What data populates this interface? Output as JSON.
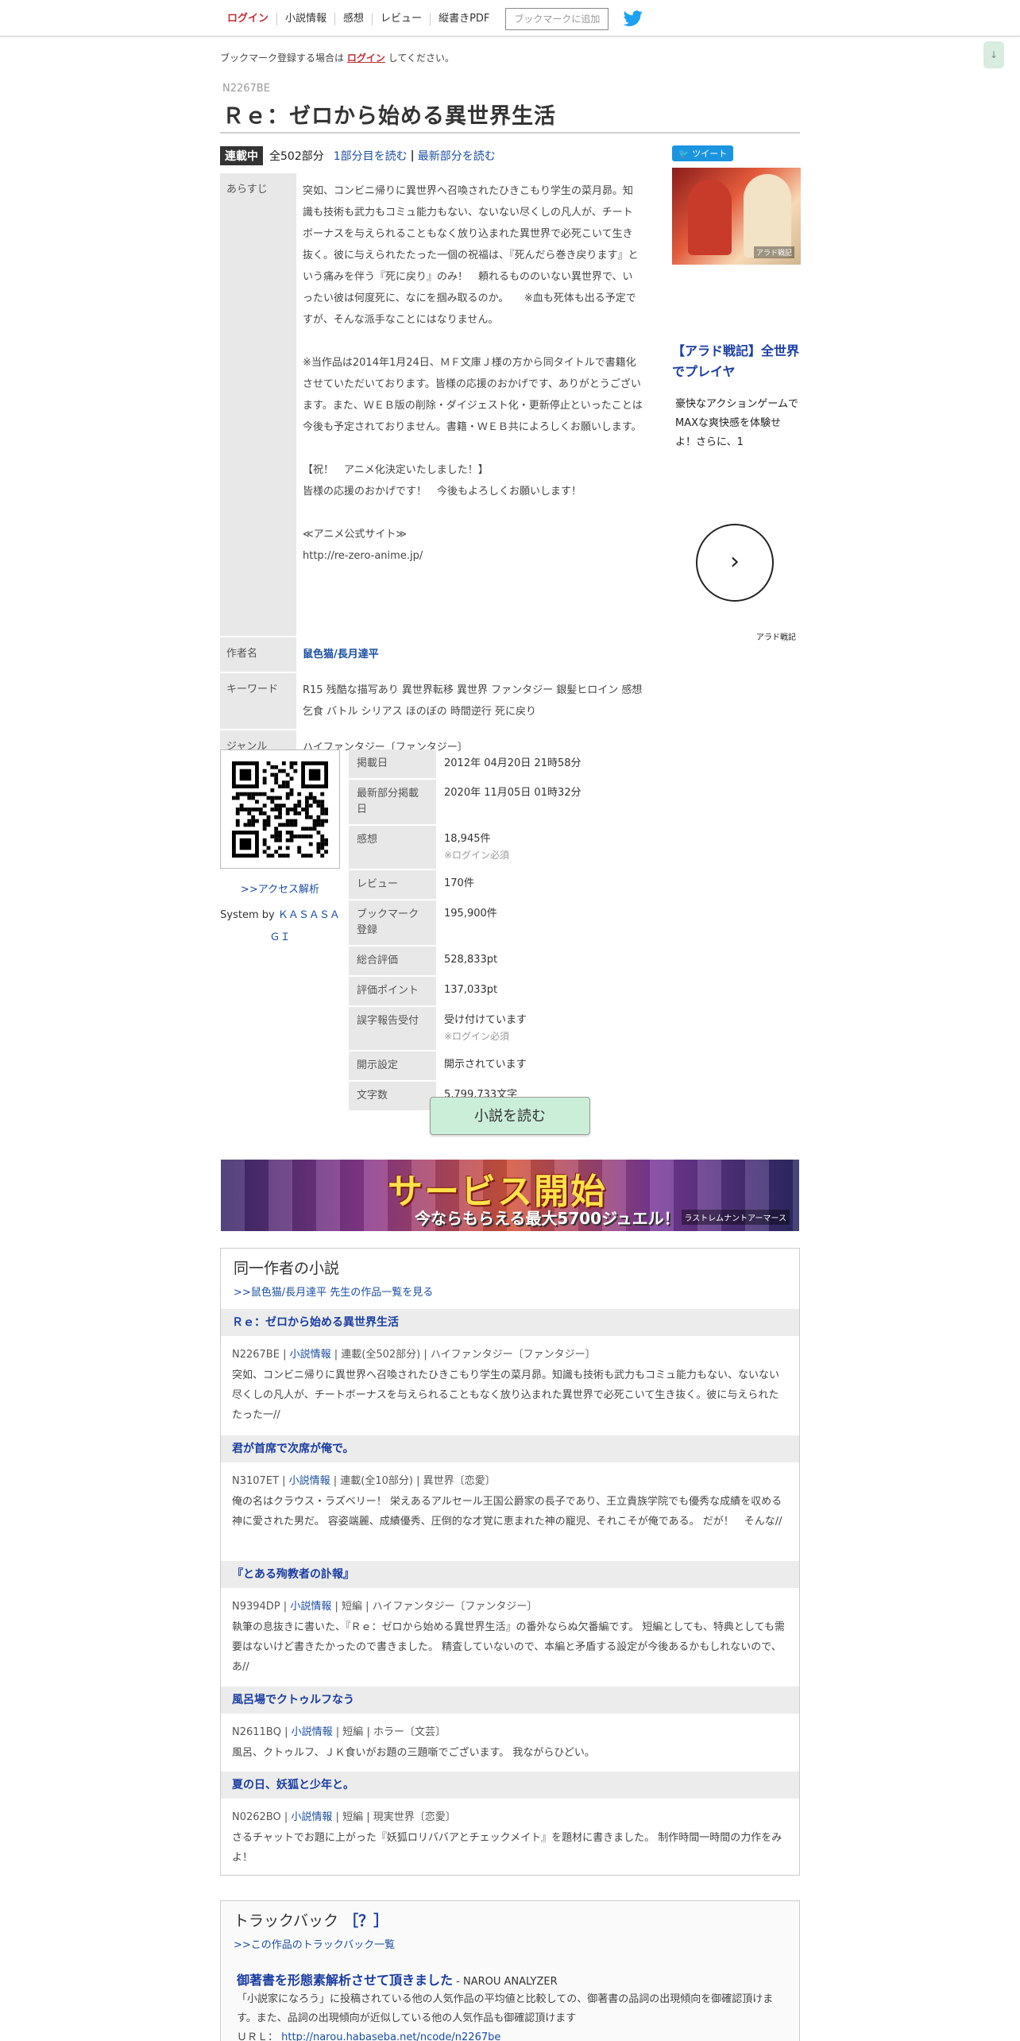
{
  "nav": {
    "login": "ログイン",
    "novel_info": "小説情報",
    "impressions": "感想",
    "review": "レビュー",
    "vertical_pdf": "縦書きPDF",
    "bookmark_button": "ブックマークに追加"
  },
  "scroll_top": "↓",
  "notice": {
    "prefix": "ブックマーク登録する場合は",
    "login": "ログイン",
    "suffix": "してください。"
  },
  "novel": {
    "ncode": "N2267BE",
    "title": "Ｒｅ：ゼロから始める異世界生活",
    "status": "連載中",
    "parts": "全502部分",
    "read_first": "1部分目を読む",
    "separator": "|",
    "read_latest": "最新部分を読む"
  },
  "info": {
    "synopsis_label": "あらすじ",
    "synopsis_p1": "突如、コンビニ帰りに異世界へ召喚されたひきこもり学生の菜月昴。知識も技術も武力もコミュ能力もない、ないない尽くしの凡人が、チートボーナスを与えられることもなく放り込まれた異世界で必死こいて生き抜く。彼に与えられたたった一個の祝福は、『死んだら巻き戻ります』という痛みを伴う『死に戻り』のみ！　頼れるもののいない異世界で、いったい彼は何度死に、なにを掴み取るのか。　　※血も死体も出る予定ですが、そんな派手なことにはなりません。",
    "synopsis_p2": "※当作品は2014年1月24日、ＭＦ文庫Ｊ様の方から同タイトルで書籍化させていただいております。皆様の応援のおかげです、ありがとうございます。また、ＷＥＢ版の削除・ダイジェスト化・更新停止といったことは今後も予定されておりません。書籍・ＷＥＢ共によろしくお願いします。",
    "synopsis_p3a": "【祝！　アニメ化決定いたしました！】",
    "synopsis_p3b": "皆様の応援のおかげです！　今後もよろしくお願いします！",
    "synopsis_p4a": "≪アニメ公式サイト≫",
    "synopsis_p4b": "http://re-zero-anime.jp/",
    "author_label": "作者名",
    "author": "鼠色猫/長月達平",
    "keyword_label": "キーワード",
    "keywords": "R15 残酷な描写あり 異世界転移  異世界 ファンタジー 銀髪ヒロイン 感想乞食 バトル シリアス ほのぼの 時間逆行 死に戻り",
    "genre_label": "ジャンル",
    "genre": "ハイファンタジー〔ファンタジー〕"
  },
  "ad": {
    "tweet": "ツイート",
    "image_logo": "アラド戦記",
    "title": "【アラド戦記】全世界でプレイヤ",
    "desc": "豪快なアクションゲームでMAXな爽快感を体験せよ！さらに、1",
    "next": "›",
    "brand": "アラド戦記"
  },
  "qr": {
    "access_link": ">>アクセス解析",
    "system_by": "System by",
    "system_name": "ＫＡＳＡＳＡＧＩ"
  },
  "stats": [
    {
      "label": "掲載日",
      "value": "2012年 04月20日 21時58分",
      "sub": ""
    },
    {
      "label": "最新部分掲載日",
      "value": "2020年 11月05日 01時32分",
      "sub": ""
    },
    {
      "label": "感想",
      "value": "18,945件",
      "sub": "※ログイン必須"
    },
    {
      "label": "レビュー",
      "value": "170件",
      "sub": ""
    },
    {
      "label": "ブックマーク登録",
      "value": "195,900件",
      "sub": ""
    },
    {
      "label": "総合評価",
      "value": "528,833pt",
      "sub": ""
    },
    {
      "label": "評価ポイント",
      "value": "137,033pt",
      "sub": ""
    },
    {
      "label": "誤字報告受付",
      "value": "受け付けています",
      "sub": "※ログイン必須"
    },
    {
      "label": "開示設定",
      "value": "開示されています",
      "sub": ""
    },
    {
      "label": "文字数",
      "value": "5,799,733文字",
      "sub": ""
    }
  ],
  "read_button": "小説を読む",
  "banner": {
    "big": "サービス開始",
    "small": "今ならもらえる最大5700ジュエル！",
    "logo": "ラストレムナントアーマース"
  },
  "same_author": {
    "title": "同一作者の小説",
    "list_link": ">>鼠色猫/長月達平 先生の作品一覧を見る",
    "info_link": "小説情報",
    "novels": [
      {
        "title": "Ｒｅ：ゼロから始める異世界生活",
        "ncode": "N2267BE",
        "type": "連載(全502部分)",
        "genre": "ハイファンタジー〔ファンタジー〕",
        "excerpt": "突如、コンビニ帰りに異世界へ召喚されたひきこもり学生の菜月昴。知識も技術も武力もコミュ能力もない、ないない尽くしの凡人が、チートボーナスを与えられることもなく放り込まれた異世界で必死こいて生き抜く。彼に与えられたたった一//"
      },
      {
        "title": "君が首席で次席が俺で。",
        "ncode": "N3107ET",
        "type": "連載(全10部分)",
        "genre": "異世界〔恋愛〕",
        "excerpt": "俺の名はクラウス・ラズベリー！ 栄えあるアルセール王国公爵家の長子であり、王立貴族学院でも優秀な成績を収める神に愛された男だ。 容姿端麗、成績優秀、圧倒的な才覚に恵まれた神の寵児、それこそが俺である。 だが！　そんな//"
      },
      {
        "title": "『とある殉教者の訃報』",
        "ncode": "N9394DP",
        "type": "短編",
        "genre": "ハイファンタジー〔ファンタジー〕",
        "excerpt": "執筆の息抜きに書いた、『Ｒｅ：ゼロから始める異世界生活』の番外ならぬ欠番編です。 短編としても、特典としても需要はないけど書きたかったので書きました。 精査していないので、本編と矛盾する設定が今後あるかもしれないので、あ//"
      },
      {
        "title": "風呂場でクトゥルフなう",
        "ncode": "N2611BQ",
        "type": "短編",
        "genre": "ホラー〔文芸〕",
        "excerpt": "風呂、クトゥルフ、ＪＫ食いがお題の三題噺でございます。 我ながらひどい。"
      },
      {
        "title": "夏の日、妖狐と少年と。",
        "ncode": "N0262BO",
        "type": "短編",
        "genre": "現実世界〔恋愛〕",
        "excerpt": "さるチャットでお題に上がった『妖狐ロリババアとチェックメイト』を題材に書きました。 制作時間一時間の力作をみよ！"
      }
    ]
  },
  "trackback": {
    "title": "トラックバック",
    "help": "［？］",
    "list_link": ">>この作品のトラックバック一覧",
    "entry_title": "御著書を形態素解析させて頂きました",
    "entry_site": " - NAROU ANALYZER",
    "entry_desc": "「小説家になろう」に投稿されている他の人気作品の平均値と比較しての、御著書の品詞の出現傾向を御確認頂けます。また、品詞の出現傾向が近似している他の人気作品も御確認頂けます",
    "url_label": "ＵＲＬ：",
    "url": "http://narou.habaseba.net/ncode/n2267be"
  }
}
